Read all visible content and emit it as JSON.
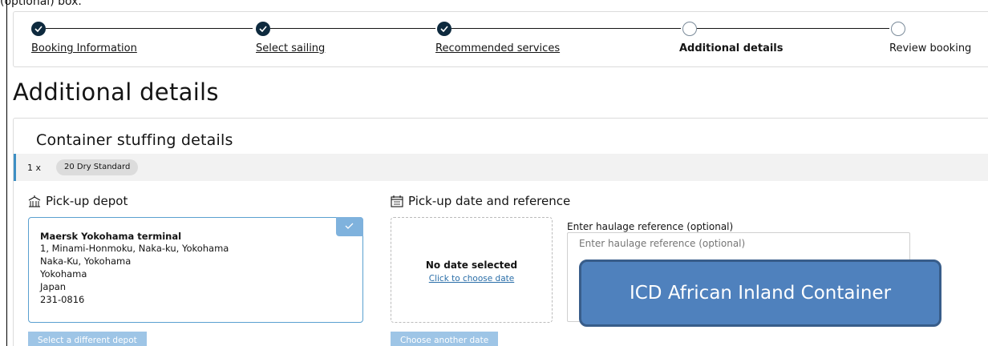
{
  "top_clip": "(optional) box.",
  "stepper": {
    "steps": [
      {
        "label": "Booking Information",
        "state": "done"
      },
      {
        "label": "Select sailing",
        "state": "done"
      },
      {
        "label": "Recommended services",
        "state": "done"
      },
      {
        "label": "Additional details",
        "state": "current"
      },
      {
        "label": "Review booking",
        "state": "todo"
      }
    ]
  },
  "page_title": "Additional details",
  "stuffing": {
    "title": "Container stuffing details",
    "quantity": "1 x",
    "container_type": "20 Dry Standard"
  },
  "depot": {
    "heading": "Pick-up depot",
    "name": "Maersk Yokohama terminal",
    "address": [
      "1, Minami-Honmoku, Naka-ku, Yokohama",
      "Naka-Ku, Yokohama",
      "Yokohama",
      "Japan",
      "231-0816"
    ],
    "change_button": "Select a different depot"
  },
  "pickup": {
    "heading": "Pick-up date and reference",
    "no_date": "No date selected",
    "choose_link": "Click to choose date",
    "another_date_button": "Choose another date",
    "ref_label": "Enter haulage reference (optional)",
    "ref_placeholder": "Enter haulage reference (optional)",
    "ref_value": ""
  },
  "callout": "ICD African Inland Container",
  "colors": {
    "accent": "#3d8fc4",
    "step_done": "#0e2a3e",
    "callout": "#4f81bd"
  }
}
